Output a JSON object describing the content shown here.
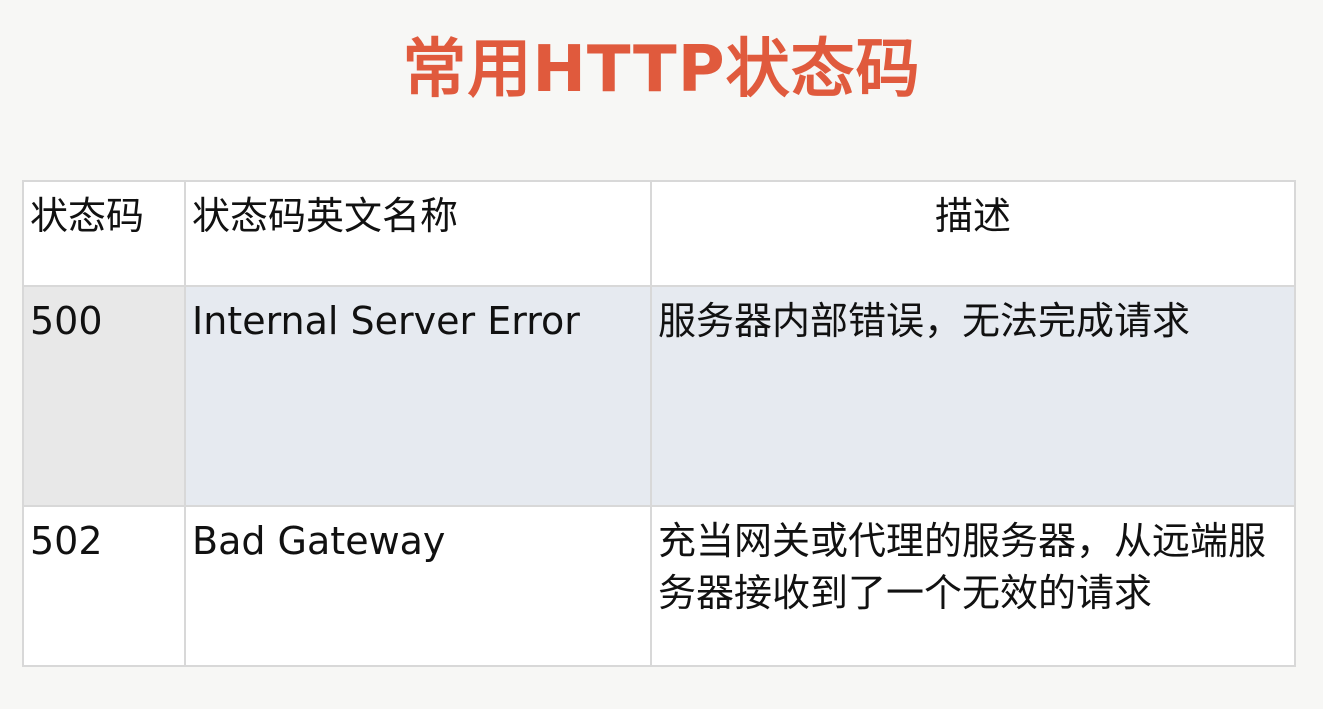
{
  "title": "常用HTTP状态码",
  "table": {
    "headers": {
      "code": "状态码",
      "name": "状态码英文名称",
      "description": "描述"
    },
    "rows": [
      {
        "code": "500",
        "name": "Internal Server Error",
        "description": "服务器内部错误，无法完成请求"
      },
      {
        "code": "502",
        "name": "Bad Gateway",
        "description": "充当网关或代理的服务器，从远端服务器接收到了一个无效的请求"
      }
    ]
  }
}
